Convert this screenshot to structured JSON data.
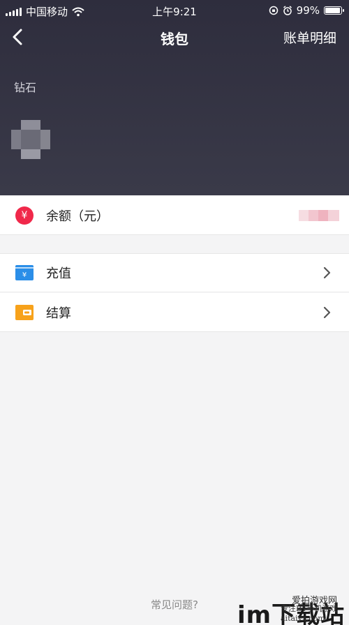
{
  "status_bar": {
    "carrier": "中国移动",
    "time": "上午9:21",
    "battery": "99%"
  },
  "nav": {
    "title": "钱包",
    "right_link": "账单明细"
  },
  "wallet": {
    "diamond_label": "钻石"
  },
  "balance": {
    "icon_glyph": "¥",
    "label": "余额（元）"
  },
  "menu": [
    {
      "label": "充值",
      "icon": "recharge-card-icon"
    },
    {
      "label": "结算",
      "icon": "wallet-icon"
    }
  ],
  "footer": {
    "faq": "常见问题?"
  },
  "watermark": {
    "big": "im下载站",
    "line1": "爱拍游戏网",
    "line2": "专注BT手机游戏",
    "line3": "aitaiyx.com"
  },
  "colors": {
    "header_bg": "#33323f",
    "balance_icon": "#f0284a",
    "recharge_icon": "#2b8ee8",
    "wallet_icon": "#f7a21b"
  }
}
